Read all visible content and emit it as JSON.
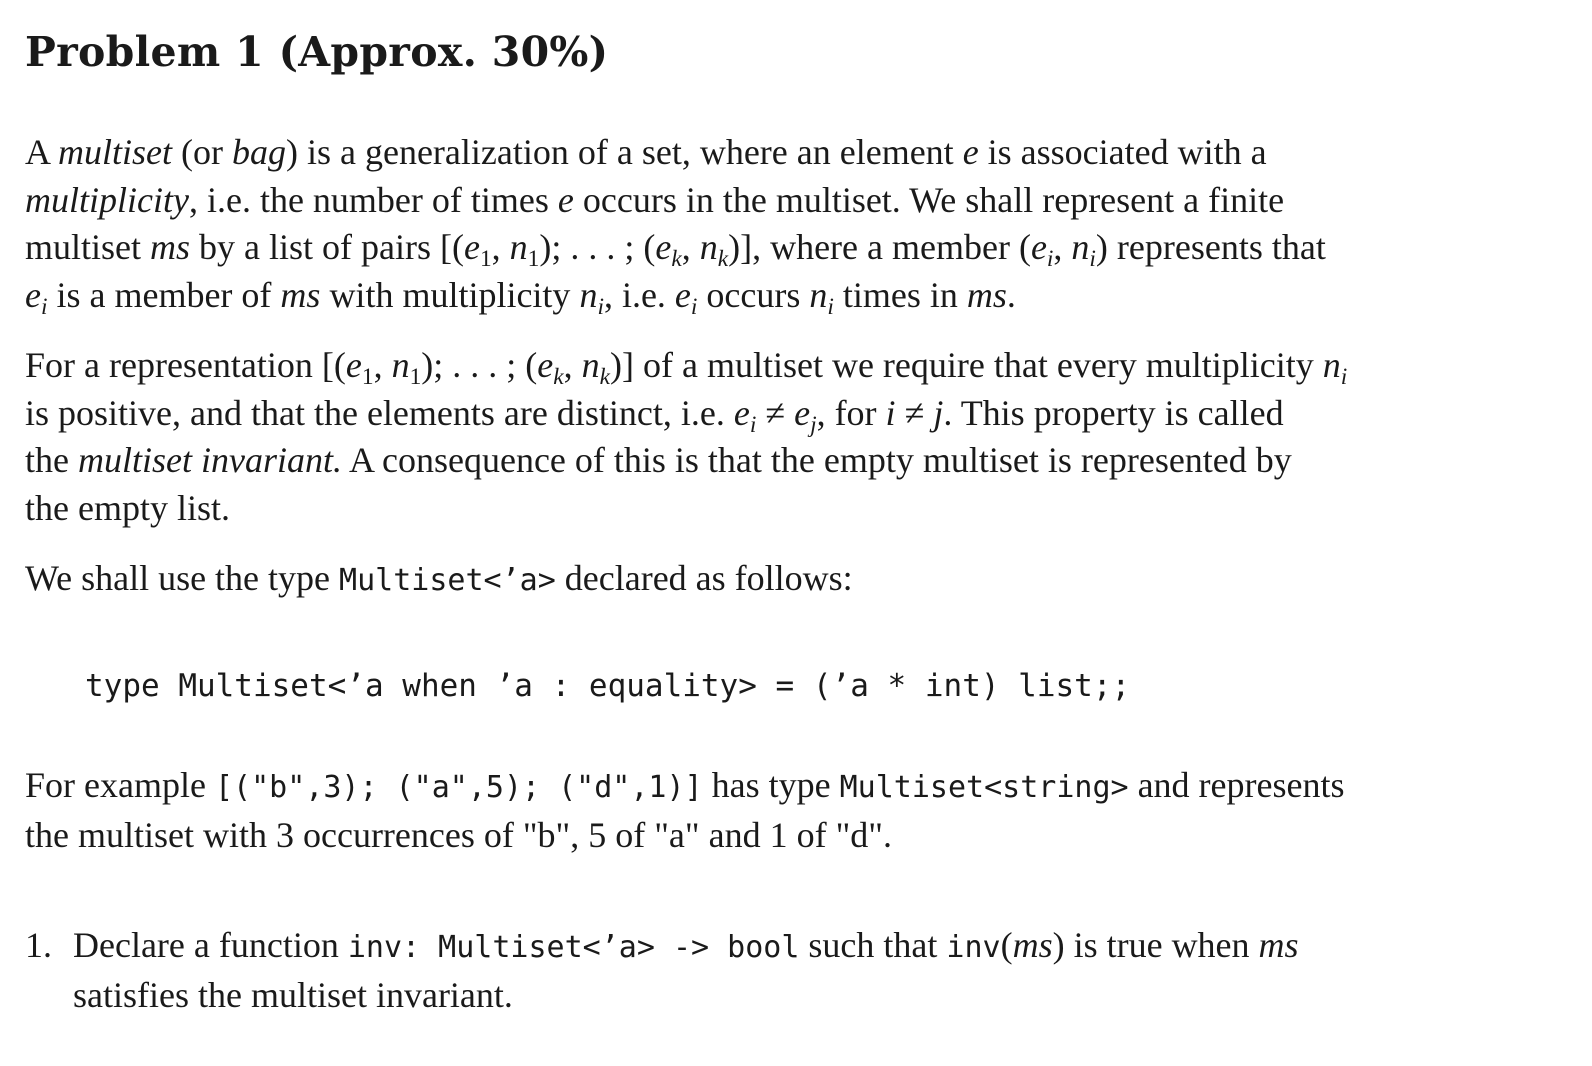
{
  "problem": {
    "title": "Problem 1 (Approx. 30%)"
  },
  "para1": {
    "l1_a": "A ",
    "l1_multiset": "multiset",
    "l1_b": " (or ",
    "l1_bag": "bag",
    "l1_c": ") is a generalization of a set, where an element ",
    "l1_e": "e",
    "l1_d": " is associated with a",
    "l2_multiplicity": "multiplicity",
    "l2_a": ", i.e. the number of times ",
    "l2_e": "e",
    "l2_b": " occurs in the multiset. We shall represent a finite",
    "l3_a": "multiset ",
    "l3_ms": "ms",
    "l3_b": " by a list of pairs [(",
    "l3_e1": "e",
    "l3_sub1": "1",
    "l3_comma1": ", ",
    "l3_n1": "n",
    "l3_sub2": "1",
    "l3_c": "); . . . ; (",
    "l3_ek": "e",
    "l3_subk": "k",
    "l3_comma2": ", ",
    "l3_nk": "n",
    "l3_subk2": "k",
    "l3_d": ")], where a member (",
    "l3_ei": "e",
    "l3_subi": "i",
    "l3_comma3": ", ",
    "l3_ni": "n",
    "l3_subi2": "i",
    "l3_e": ") represents that",
    "l4_ei": "e",
    "l4_subi": "i",
    "l4_a": " is a member of ",
    "l4_ms": "ms",
    "l4_b": " with multiplicity ",
    "l4_ni": "n",
    "l4_subi2": "i",
    "l4_c": ", i.e. ",
    "l4_ei2": "e",
    "l4_subi3": "i",
    "l4_d": " occurs ",
    "l4_ni2": "n",
    "l4_subi4": "i",
    "l4_e": " times in ",
    "l4_ms2": "ms",
    "l4_f": "."
  },
  "para2": {
    "l1_a": "For a representation [(",
    "l1_e1": "e",
    "l1_sub1": "1",
    "l1_comma1": ", ",
    "l1_n1": "n",
    "l1_sub2": "1",
    "l1_b": "); . . . ; (",
    "l1_ek": "e",
    "l1_subk": "k",
    "l1_comma2": ", ",
    "l1_nk": "n",
    "l1_subk2": "k",
    "l1_c": ")] of a multiset we require that every multiplicity ",
    "l1_ni": "n",
    "l1_subi": "i",
    "l2_a": "is positive, and that the elements are distinct, i.e. ",
    "l2_ei": "e",
    "l2_subi": "i",
    "l2_neq": " ≠ ",
    "l2_ej": "e",
    "l2_subj": "j",
    "l2_b": ", for ",
    "l2_i": "i",
    "l2_neq2": " ≠ ",
    "l2_j": "j",
    "l2_c": ". This property is called",
    "l3_a": "the ",
    "l3_inv": "multiset invariant.",
    "l3_b": " A consequence of this is that the empty multiset is represented by",
    "l4": "the empty list."
  },
  "para3": {
    "a": "We shall use the type ",
    "code": "Multiset<’a>",
    "b": " declared as follows:"
  },
  "code_block": {
    "line": "type Multiset<’a when ’a : equality> = (’a * int) list;;"
  },
  "para4": {
    "l1_a": "For example ",
    "l1_code": "[(\"b\",3); (\"a\",5); (\"d\",1)]",
    "l1_b": " has type ",
    "l1_code2": "Multiset<string>",
    "l1_c": " and represents",
    "l2": "the multiset with 3 occurrences of \"b\", 5 of \"a\" and 1 of \"d\"."
  },
  "list": {
    "num": "1.",
    "l1_a": "Declare a function ",
    "l1_code": "inv: Multiset<’a> -> bool",
    "l1_b": " such that ",
    "l1_code2": "inv",
    "l1_c": "(",
    "l1_ms": "ms",
    "l1_d": ") is true when ",
    "l1_ms2": "ms",
    "l2": "satisfies the multiset invariant."
  }
}
